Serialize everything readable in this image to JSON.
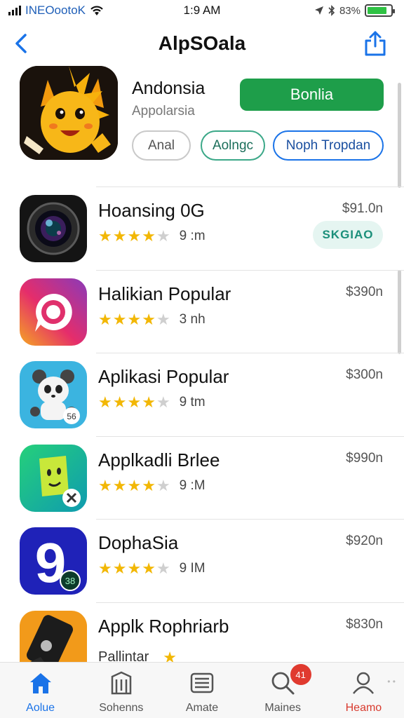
{
  "status_bar": {
    "carrier": "INEOootoK",
    "time": "1:9 AM",
    "battery_text": "83%",
    "battery_level": 0.83
  },
  "nav": {
    "title": "AlpSOala"
  },
  "featured": {
    "name": "Andonsia",
    "subtitle": "Appolarsia",
    "get_label": "Bonlia",
    "pills": [
      "Anal",
      "Aolngc",
      "Noph Tropdan"
    ]
  },
  "apps": [
    {
      "name": "Hoansing 0G",
      "rating": 4,
      "meta": "9 :m",
      "price": "$91.0n",
      "badge": "SKGIAO",
      "icon": "camera-lens-icon"
    },
    {
      "name": "Halikian Popular",
      "rating": 4,
      "meta": "3 nh",
      "price": "$390n",
      "icon": "instagram-style-icon"
    },
    {
      "name": "Aplikasi Popular",
      "rating": 4,
      "meta": "9 tm",
      "price": "$300n",
      "icon": "panda-icon"
    },
    {
      "name": "Applkadli Brlee",
      "rating": 4,
      "meta": "9 :M",
      "price": "$990n",
      "icon": "green-character-icon"
    },
    {
      "name": "DophaSia",
      "rating": 4,
      "meta": "9 IM",
      "price": "$920n",
      "icon": "number-nine-icon"
    },
    {
      "name": "Applk Rophriarb",
      "subtitle": "Pallintar",
      "rating": 1,
      "meta": "",
      "price": "$830n",
      "icon": "phone-hand-icon"
    }
  ],
  "tabs": [
    {
      "label": "Aolue",
      "icon": "home-icon"
    },
    {
      "label": "Sohenns",
      "icon": "store-icon"
    },
    {
      "label": "Amate",
      "icon": "list-icon"
    },
    {
      "label": "Maines",
      "icon": "search-icon",
      "badge": "41"
    },
    {
      "label": "Heamo",
      "icon": "profile-icon"
    }
  ],
  "colors": {
    "accent": "#1a73e8",
    "get_button": "#1e9e4a",
    "star": "#f2b705",
    "badge_text": "#1b8f7a",
    "notification": "#e03a2f"
  }
}
